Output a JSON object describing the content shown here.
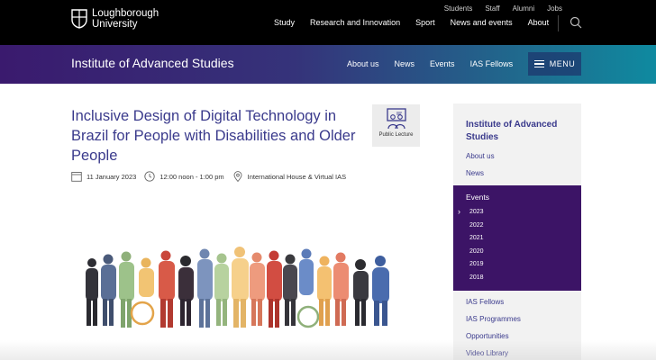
{
  "header": {
    "logo_line1": "Loughborough",
    "logo_line2": "University",
    "utility_links": [
      "Students",
      "Staff",
      "Alumni",
      "Jobs"
    ],
    "main_nav": [
      "Study",
      "Research and Innovation",
      "Sport",
      "News and events",
      "About"
    ],
    "search_icon": "search-icon"
  },
  "section_bar": {
    "title": "Institute of Advanced Studies",
    "nav": [
      "About us",
      "News",
      "Events",
      "IAS Fellows"
    ],
    "menu_label": "MENU",
    "gradient_colors": [
      "#3a1a6e",
      "#0f8aa0"
    ]
  },
  "event": {
    "title": "Inclusive Design of Digital Technology in Brazil for People with Disabilities and Older People",
    "badge_label": "Public Lecture",
    "date": "11 January 2023",
    "time": "12:00 noon - 1:00 pm",
    "location": "International House & Virtual IAS"
  },
  "sidebar": {
    "title": "Institute of Advanced Studies",
    "top_links": [
      "About us",
      "News"
    ],
    "events_label": "Events",
    "years": [
      "2023",
      "2022",
      "2021",
      "2020",
      "2019",
      "2018"
    ],
    "bottom_links": [
      "IAS Fellows",
      "IAS Programmes",
      "Opportunities",
      "Video Library"
    ],
    "accent_color": "#3c1466",
    "link_color": "#3a3a8c"
  }
}
